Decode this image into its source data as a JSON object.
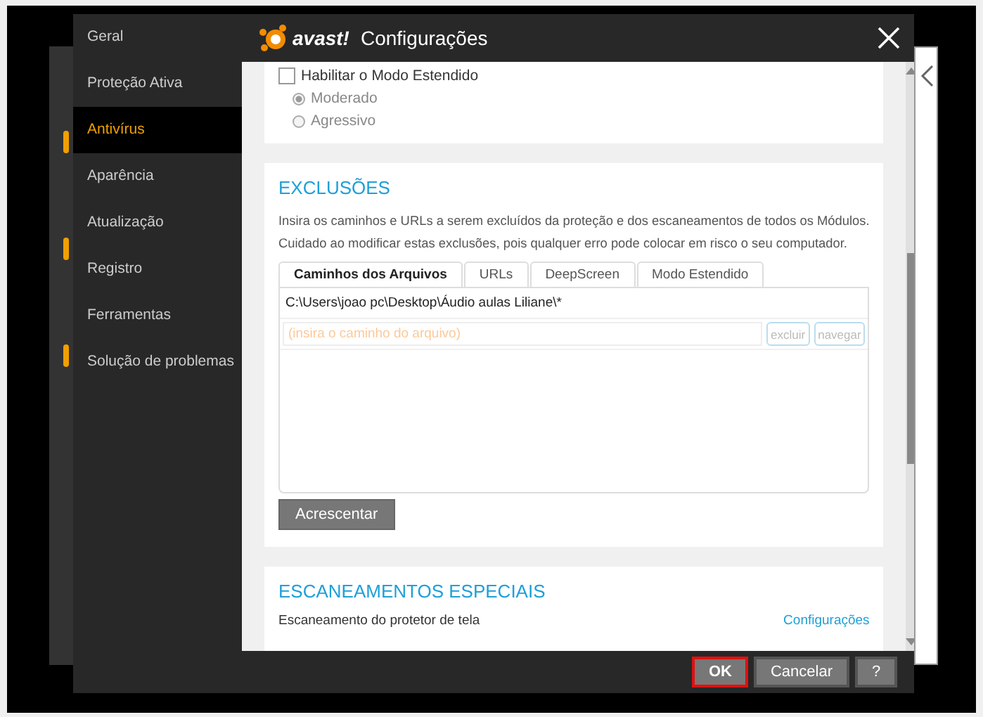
{
  "window": {
    "logo": "avast!",
    "title": "Configurações"
  },
  "sidebar": {
    "items": [
      {
        "label": "Geral",
        "selected": false
      },
      {
        "label": "Proteção Ativa",
        "selected": false
      },
      {
        "label": "Antivírus",
        "selected": true
      },
      {
        "label": "Aparência",
        "selected": false
      },
      {
        "label": "Atualização",
        "selected": false
      },
      {
        "label": "Registro",
        "selected": false
      },
      {
        "label": "Ferramentas",
        "selected": false
      },
      {
        "label": "Solução de problemas",
        "selected": false
      }
    ]
  },
  "extended_mode": {
    "checkbox": {
      "label": "Habilitar o Modo Estendido",
      "checked": false
    },
    "options": [
      {
        "label": "Moderado",
        "selected": true
      },
      {
        "label": "Agressivo",
        "selected": false
      }
    ]
  },
  "exclusions": {
    "title": "EXCLUSÕES",
    "description": [
      "Insira os caminhos e URLs a serem excluídos da proteção e dos escaneamentos de todos os Módulos.",
      "Cuidado ao modificar estas exclusões, pois qualquer erro pode colocar em risco o seu computador."
    ],
    "tabs": [
      {
        "label": "Caminhos dos Arquivos",
        "selected": true
      },
      {
        "label": "URLs",
        "selected": false
      },
      {
        "label": "DeepScreen",
        "selected": false
      },
      {
        "label": "Modo Estendido",
        "selected": false
      }
    ],
    "entries": [
      "C:\\Users\\joao pc\\Desktop\\Áudio aulas Liliane\\*"
    ],
    "input": {
      "placeholder": "(insira o caminho do arquivo)"
    },
    "input_buttons": [
      {
        "label": "excluir",
        "disabled": true
      },
      {
        "label": "navegar",
        "disabled": true
      }
    ],
    "add_button": "Acrescentar"
  },
  "special_scans": {
    "title": "ESCANEAMENTOS ESPECIAIS",
    "rows": [
      {
        "label": "Escaneamento do protetor de tela",
        "link": "Configurações"
      }
    ]
  },
  "footer": {
    "buttons": [
      {
        "label": "OK",
        "kind": "primary",
        "highlighted": true
      },
      {
        "label": "Cancelar",
        "kind": "normal",
        "highlighted": false
      },
      {
        "label": "?",
        "kind": "help",
        "highlighted": false
      }
    ]
  }
}
